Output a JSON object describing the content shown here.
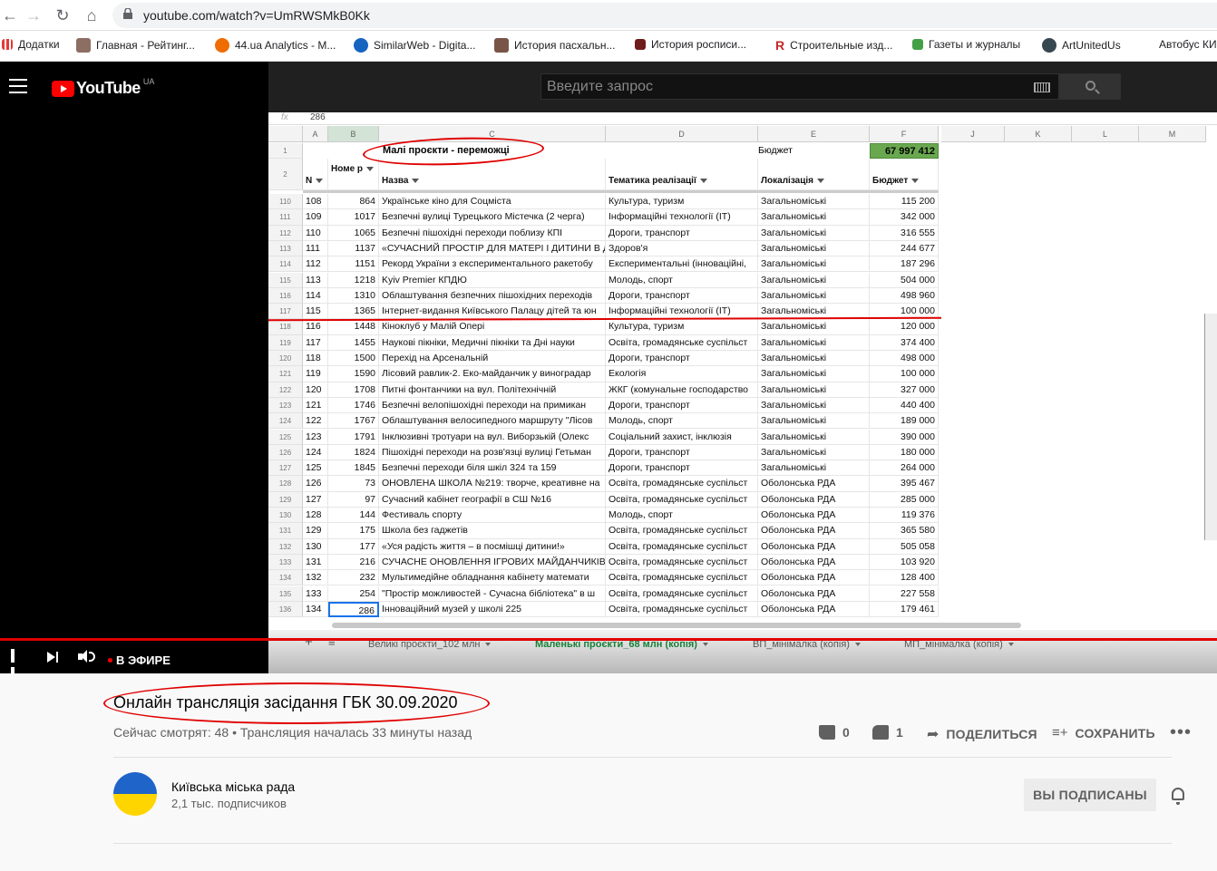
{
  "browser": {
    "url": "youtube.com/watch?v=UmRWSMkB0Kk",
    "bookmarks": [
      {
        "label": "Додатки",
        "color": "#e53935"
      },
      {
        "label": "Главная - Рейтинг...",
        "color": "#8d6e63"
      },
      {
        "label": "44.ua Analytics - M...",
        "color": "#ef6c00"
      },
      {
        "label": "SimilarWeb - Digita...",
        "color": "#1565c0"
      },
      {
        "label": "История пасхальн...",
        "color": "#795548"
      },
      {
        "label": "История росписи...",
        "color": "#6d1b1b"
      },
      {
        "label": "Строительные изд...",
        "color": "#c62828"
      },
      {
        "label": "Газеты и журналы",
        "color": "#43a047"
      },
      {
        "label": "ArtUnitedUs",
        "color": "#37474f"
      },
      {
        "label": "Автобус КИ",
        "color": "#ffffff"
      }
    ]
  },
  "youtube": {
    "logo_text": "YouTube",
    "country": "UA",
    "search_placeholder": "Введите запрос"
  },
  "sheet": {
    "formula_value": "286",
    "columns": [
      "A",
      "B",
      "C",
      "D",
      "E",
      "F",
      "J",
      "K",
      "L",
      "M"
    ],
    "title": "Малі проєкти - переможці",
    "budget_label": "Бюджет",
    "budget_total": "67 997 412",
    "headers": {
      "n": "N",
      "nomer": "Номе р",
      "name": "Назва",
      "topic": "Тематика реалізації",
      "location": "Локалізація",
      "budget": "Бюджет"
    },
    "rows": [
      {
        "row": "110",
        "n": "108",
        "nomer": "864",
        "name": "Українське кіно для Соцмістa",
        "topic": "Культура, туризм",
        "loc": "Загальноміські",
        "budget": "115 200"
      },
      {
        "row": "111",
        "n": "109",
        "nomer": "1017",
        "name": "Безпечні вулиці Турецького Містечка (2 черга)",
        "topic": "Інформаційні технології (ІТ)",
        "loc": "Загальноміські",
        "budget": "342 000"
      },
      {
        "row": "112",
        "n": "110",
        "nomer": "1065",
        "name": "Безпечні пішохідні переходи поблизу КПІ",
        "topic": "Дороги, транспорт",
        "loc": "Загальноміські",
        "budget": "316 555"
      },
      {
        "row": "113",
        "n": "111",
        "nomer": "1137",
        "name": "«СУЧАСНИЙ ПРОСТІР ДЛЯ МАТЕРІ І ДИТИНИ В Д",
        "topic": "Здоров'я",
        "loc": "Загальноміські",
        "budget": "244 677"
      },
      {
        "row": "114",
        "n": "112",
        "nomer": "1151",
        "name": "Рекорд України з експериментального ракетобу",
        "topic": "Експериментальні (інноваційні,",
        "loc": "Загальноміські",
        "budget": "187 296"
      },
      {
        "row": "115",
        "n": "113",
        "nomer": "1218",
        "name": "Kyiv Premier КПДЮ",
        "topic": "Молодь, спорт",
        "loc": "Загальноміські",
        "budget": "504 000"
      },
      {
        "row": "116",
        "n": "114",
        "nomer": "1310",
        "name": "Облаштування безпечних пішохідних переходів",
        "topic": "Дороги, транспорт",
        "loc": "Загальноміські",
        "budget": "498 960"
      },
      {
        "row": "117",
        "n": "115",
        "nomer": "1365",
        "name": "Інтернет-видання Київського Палацу дітей та юн",
        "topic": "Інформаційні технології (ІТ)",
        "loc": "Загальноміські",
        "budget": "100 000"
      },
      {
        "row": "118",
        "n": "116",
        "nomer": "1448",
        "name": "Кіноклуб у Малій Опері",
        "topic": "Культура, туризм",
        "loc": "Загальноміські",
        "budget": "120 000"
      },
      {
        "row": "119",
        "n": "117",
        "nomer": "1455",
        "name": "Наукові пікніки, Медичні пікніки та Дні науки",
        "topic": "Освіта, громадянське суспільст",
        "loc": "Загальноміські",
        "budget": "374 400"
      },
      {
        "row": "120",
        "n": "118",
        "nomer": "1500",
        "name": "Перехід на Арсенальній",
        "topic": "Дороги, транспорт",
        "loc": "Загальноміські",
        "budget": "498 000"
      },
      {
        "row": "121",
        "n": "119",
        "nomer": "1590",
        "name": "Лісовий равлик-2. Еко-майданчик у виноградар",
        "topic": "Екологія",
        "loc": "Загальноміські",
        "budget": "100 000"
      },
      {
        "row": "122",
        "n": "120",
        "nomer": "1708",
        "name": "Питні фонтанчики на вул. Політехнічній",
        "topic": "ЖКГ (комунальне господарство",
        "loc": "Загальноміські",
        "budget": "327 000"
      },
      {
        "row": "123",
        "n": "121",
        "nomer": "1746",
        "name": "Безпечні велопішохідні переходи на примикан",
        "topic": "Дороги, транспорт",
        "loc": "Загальноміські",
        "budget": "440 400"
      },
      {
        "row": "124",
        "n": "122",
        "nomer": "1767",
        "name": "Облаштування велосипедного маршруту \"Лісов",
        "topic": "Молодь, спорт",
        "loc": "Загальноміські",
        "budget": "189 000"
      },
      {
        "row": "125",
        "n": "123",
        "nomer": "1791",
        "name": "Інклюзивні тротуари на вул. Виборзькій (Олекс",
        "topic": "Соціальний захист, інклюзія",
        "loc": "Загальноміські",
        "budget": "390 000"
      },
      {
        "row": "126",
        "n": "124",
        "nomer": "1824",
        "name": "Пішохідні переходи на розв'язці вулиці Гетьман",
        "topic": "Дороги, транспорт",
        "loc": "Загальноміські",
        "budget": "180 000"
      },
      {
        "row": "127",
        "n": "125",
        "nomer": "1845",
        "name": "Безпечні переходи біля шкіл 324 та 159",
        "topic": "Дороги, транспорт",
        "loc": "Загальноміські",
        "budget": "264 000"
      },
      {
        "row": "128",
        "n": "126",
        "nomer": "73",
        "name": "ОНОВЛЕНА ШКОЛА №219: творче, креативне на",
        "topic": "Освіта, громадянське суспільст",
        "loc": "Оболонська РДА",
        "budget": "395 467"
      },
      {
        "row": "129",
        "n": "127",
        "nomer": "97",
        "name": "Сучасний кабінет географії в СШ №16",
        "topic": "Освіта, громадянське суспільст",
        "loc": "Оболонська РДА",
        "budget": "285 000"
      },
      {
        "row": "130",
        "n": "128",
        "nomer": "144",
        "name": "Фестиваль спорту",
        "topic": "Молодь, спорт",
        "loc": "Оболонська РДА",
        "budget": "119 376"
      },
      {
        "row": "131",
        "n": "129",
        "nomer": "175",
        "name": "Школа без гаджетів",
        "topic": "Освіта, громадянське суспільст",
        "loc": "Оболонська РДА",
        "budget": "365 580"
      },
      {
        "row": "132",
        "n": "130",
        "nomer": "177",
        "name": "«Уся радість життя – в посмішці дитини!»",
        "topic": "Освіта, громадянське суспільст",
        "loc": "Оболонська РДА",
        "budget": "505 058"
      },
      {
        "row": "133",
        "n": "131",
        "nomer": "216",
        "name": "СУЧАСНЕ ОНОВЛЕННЯ ІГРОВИХ МАЙДАНЧИКІВ",
        "topic": "Освіта, громадянське суспільст",
        "loc": "Оболонська РДА",
        "budget": "103 920"
      },
      {
        "row": "134",
        "n": "132",
        "nomer": "232",
        "name": "Мультимедійне обладнання кабінету математи",
        "topic": "Освіта, громадянське суспільст",
        "loc": "Оболонська РДА",
        "budget": "128 400"
      },
      {
        "row": "135",
        "n": "133",
        "nomer": "254",
        "name": "\"Простір можливостей - Сучасна бібліотека\" в ш",
        "topic": "Освіта, громадянське суспільст",
        "loc": "Оболонська РДА",
        "budget": "227 558"
      },
      {
        "row": "136",
        "n": "134",
        "nomer": "286",
        "name": "Інноваційний музей у школі 225",
        "topic": "Освіта, громадянське суспільст",
        "loc": "Оболонська РДА",
        "budget": "179 461"
      }
    ],
    "tabs": [
      "Великі проєкти_102 млн",
      "Маленькі проєкти_68 млн (копія)",
      "ВП_мінімалка (копія)",
      "МП_мінімалка (копія)"
    ],
    "active_tab": 1
  },
  "player": {
    "live_label": "В ЭФИРЕ"
  },
  "video": {
    "title": "Онлайн трансляція засідання ГБК 30.09.2020",
    "meta": "Сейчас смотрят: 48 • Трансляция началась 33 минуты назад",
    "likes": "0",
    "dislikes": "1",
    "share_label": "ПОДЕЛИТЬСЯ",
    "save_label": "СОХРАНИТЬ"
  },
  "channel": {
    "name": "Київська міська рада",
    "subscribers": "2,1 тыс. подписчиков",
    "subscribe_label": "ВЫ ПОДПИСАНЫ",
    "avatar_colors": [
      "#1f64c8",
      "#ffd500"
    ]
  },
  "colors": {
    "accent_red": "#e00000",
    "budget_green": "#6aa84f"
  }
}
